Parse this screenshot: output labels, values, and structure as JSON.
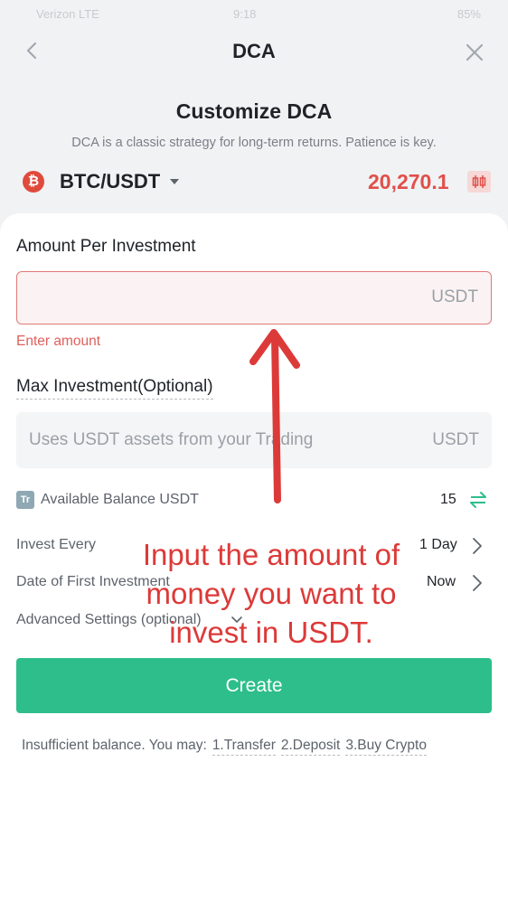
{
  "status_bar": {
    "left": "Verizon LTE",
    "time": "9:18",
    "right": "85%"
  },
  "nav": {
    "title": "DCA",
    "back_icon": "chevron-left-icon",
    "close_icon": "close-icon"
  },
  "header": {
    "title": "Customize DCA",
    "subtitle": "DCA is a classic strategy for long-term returns. Patience is key."
  },
  "pair": {
    "icon_glyph": "₿",
    "name": "BTC/USDT",
    "price": "20,270.1",
    "price_color": "#e0504a"
  },
  "amount_per_investment": {
    "label": "Amount Per Investment",
    "value": "",
    "unit": "USDT",
    "error": "Enter amount"
  },
  "max_investment": {
    "label": "Max Investment(Optional)",
    "placeholder": "Uses USDT assets from your Trading",
    "unit": "USDT"
  },
  "balance": {
    "icon_glyph": "Tr",
    "label": "Available Balance USDT",
    "value": "15"
  },
  "settings": {
    "invest_every": {
      "label": "Invest Every",
      "value": "1 Day"
    },
    "first_investment": {
      "label": "Date of First Investment",
      "value": "Now"
    },
    "advanced": {
      "label": "Advanced Settings (optional)"
    }
  },
  "create_button": {
    "label": "Create",
    "color": "#2dbe8c"
  },
  "insufficient": {
    "text": "Insufficient balance. You may:",
    "options": [
      "1.Transfer",
      "2.Deposit",
      "3.Buy Crypto"
    ]
  },
  "annotation": {
    "line1": "Input the amount of",
    "line2": "money you want to",
    "line3": "invest in USDT.",
    "color": "#dc3a38"
  }
}
